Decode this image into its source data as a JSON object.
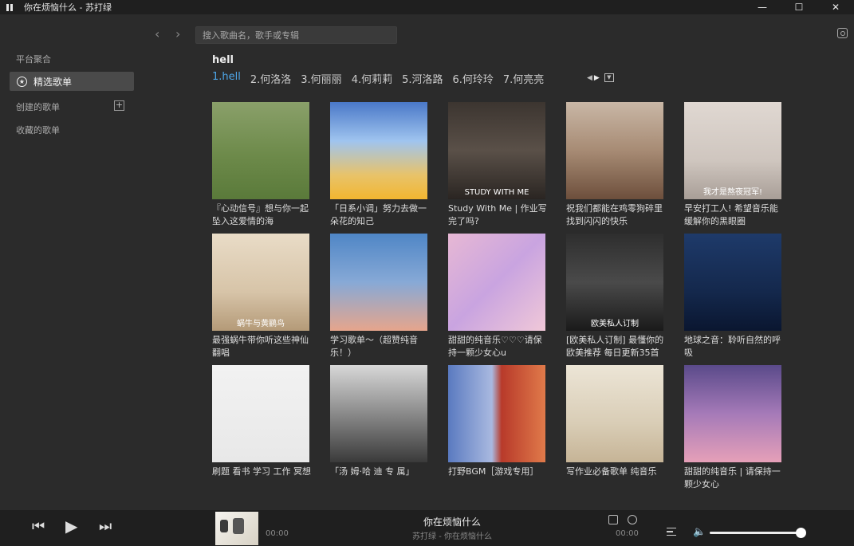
{
  "window": {
    "title": "你在烦恼什么 - 苏打绿",
    "controls": [
      "—",
      "☐",
      "✕"
    ]
  },
  "sidebar": {
    "heading": "平台聚合",
    "active_item": "精选歌单",
    "created_label": "创建的歌单",
    "collected_label": "收藏的歌单"
  },
  "topbar": {
    "back": "‹",
    "forward": "›",
    "search_placeholder": "搜入歌曲名，歌手或专辑"
  },
  "main": {
    "query": "hell",
    "tabs": [
      "1.hell",
      "2.何洛洛",
      "3.何丽丽",
      "4.何莉莉",
      "5.河洛路",
      "6.何玲玲",
      "7.何亮亮"
    ],
    "active_tab": 0,
    "playlists": [
      {
        "name": "『心动信号』想与你一起坠入这爱情的海",
        "bg": "linear-gradient(180deg,#8aa06a 0%,#6d8a4a 55%,#5a7a3a 100%)",
        "cap": ""
      },
      {
        "name": "「日系小调」努力去做一朵花的知己",
        "bg": "linear-gradient(180deg,#4a78c8 0%,#9fc4ef 40%,#e8c36a 75%,#f2b630 100%)",
        "cap": ""
      },
      {
        "name": "Study With Me | 作业写完了吗?",
        "bg": "linear-gradient(180deg,#3c3530 0%,#5a5048 50%,#2a2522 100%)",
        "cap": "STUDY WITH ME"
      },
      {
        "name": "祝我们都能在鸡零狗碎里找到闪闪的快乐",
        "bg": "linear-gradient(180deg,#c9b7a6 0%,#a78b74 50%,#6d4f3c 100%)",
        "cap": ""
      },
      {
        "name": "早安打工人! 希望音乐能缓解你的黑眼圈",
        "bg": "linear-gradient(180deg,#e0d8d2 0%,#cfc6bf 60%,#a89e97 100%)",
        "cap": "我才是熬夜冠军!"
      },
      {
        "name": "最强蜗牛带你听这些神仙翻唱",
        "bg": "linear-gradient(180deg,#e9dcc7 0%,#d7c4a8 60%,#b49a78 100%)",
        "cap": "蜗牛与黄鹂鸟"
      },
      {
        "name": "学习歌单～（超赞纯音乐！）",
        "bg": "linear-gradient(180deg,#4f86c6 0%,#87a9d6 50%,#e6a58c 100%)",
        "cap": ""
      },
      {
        "name": "甜甜的纯音乐♡♡♡请保持一颗少女心u",
        "bg": "linear-gradient(135deg,#e7b8d4 0%,#c9a4e0 50%,#f0c8d8 100%)",
        "cap": ""
      },
      {
        "name": "[欧美私人订制] 最懂你的欧美推荐 每日更新35首",
        "bg": "linear-gradient(180deg,#2e2e2e 0%,#4a4a4a 50%,#1a1a1a 100%)",
        "cap": "欧美私人订制"
      },
      {
        "name": "地球之音：聆听自然的呼吸",
        "bg": "linear-gradient(180deg,#1e3a6a 0%,#14284c 60%,#0a1630 100%)",
        "cap": ""
      },
      {
        "name": "刷题 看书 学习 工作 冥想",
        "bg": "linear-gradient(180deg,#f2f2f2 0%,#e8e8e8 100%)",
        "cap": ""
      },
      {
        "name": "「汤 姆·哈 迪 专 属」",
        "bg": "linear-gradient(180deg,#d8d8d8 0%,#8a8a8a 50%,#3a3a3a 100%)",
        "cap": ""
      },
      {
        "name": "打野BGM［游戏专用］",
        "bg": "linear-gradient(90deg,#5a7ac0 0%,#a9b9e0 45%,#b83a2a 55%,#e07a4a 100%)",
        "cap": ""
      },
      {
        "name": "写作业必备歌单 纯音乐",
        "bg": "linear-gradient(180deg,#ece5d6 0%,#d9cdb6 60%,#c6b496 100%)",
        "cap": ""
      },
      {
        "name": "甜甜的纯音乐 | 请保持一颗少女心",
        "bg": "linear-gradient(180deg,#5a4a8a 0%,#a57ab8 50%,#e6a0b8 100%)",
        "cap": ""
      }
    ]
  },
  "player": {
    "prev": "⏮",
    "play": "▶",
    "next": "⏭",
    "elapsed": "00:00",
    "total": "00:00",
    "song": "你在烦恼什么",
    "artist_album": "苏打绿 - 你在烦恼什么",
    "volume": 0.95
  }
}
